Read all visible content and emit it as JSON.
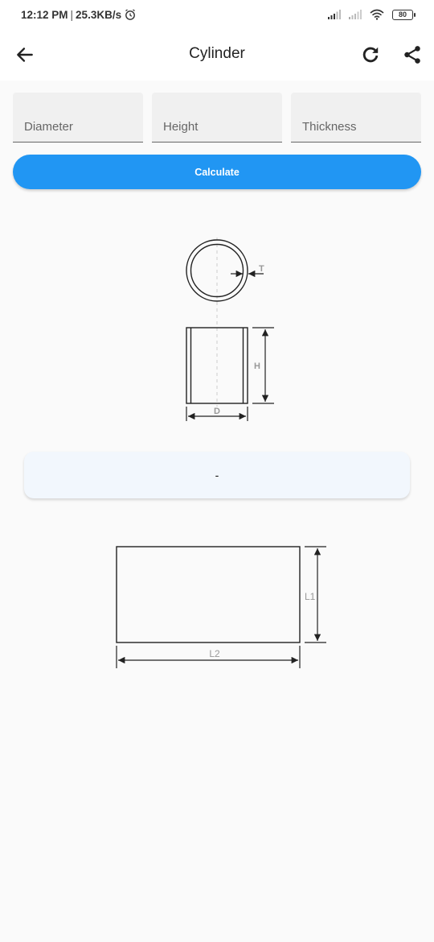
{
  "status_bar": {
    "time": "12:12 PM",
    "separator": "|",
    "network_speed": "25.3KB/s",
    "alarm_icon": "alarm-icon",
    "signal_icons": [
      "signal-icon",
      "signal-weak-icon"
    ],
    "wifi_icon": "wifi-icon",
    "battery_level": "80"
  },
  "app_bar": {
    "title": "Cylinder",
    "back_icon": "arrow-left-icon",
    "refresh_icon": "refresh-icon",
    "share_icon": "share-icon"
  },
  "inputs": {
    "diameter": {
      "placeholder": "Diameter",
      "value": ""
    },
    "height": {
      "placeholder": "Height",
      "value": ""
    },
    "thickness": {
      "placeholder": "Thickness",
      "value": ""
    }
  },
  "calculate_label": "Calculate",
  "diagram_cylinder": {
    "label_thickness": "T",
    "label_height": "H",
    "label_diameter": "D"
  },
  "result": {
    "value": "-"
  },
  "diagram_sheet": {
    "label_l1": "L1",
    "label_l2": "L2"
  },
  "colors": {
    "accent": "#2196f3",
    "background": "#fafafa",
    "field_bg": "#f0f0f0",
    "result_bg": "#f2f7fd",
    "dimension_label": "#999999"
  }
}
